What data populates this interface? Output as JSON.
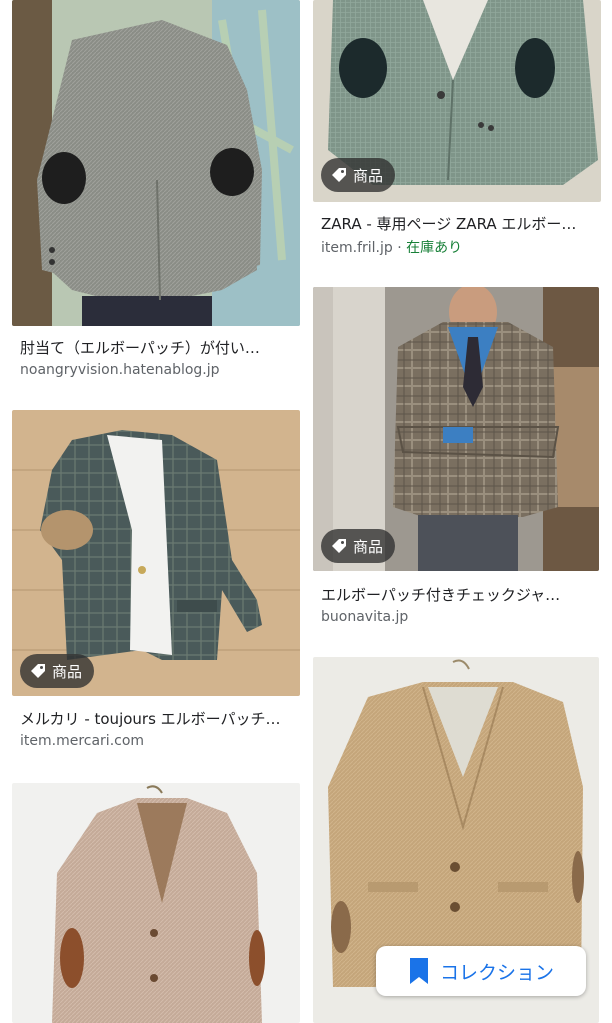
{
  "results": [
    {
      "title": "肘当て（エルボーパッチ）が付い…",
      "source": "noangryvision.hatenablog.jp"
    },
    {
      "title": "ZARA - 専用ページ ZARA エルボー…",
      "source": "item.fril.jp",
      "separator": " · ",
      "stock": "在庫あり",
      "badge": "商品"
    },
    {
      "title": "エルボーパッチ付きチェックジャ…",
      "source": "buonavita.jp",
      "badge": "商品"
    },
    {
      "title": "メルカリ - toujours エルボーパッチ…",
      "source": "item.mercari.com",
      "badge": "商品"
    }
  ],
  "collection_button": {
    "label": "コレクション",
    "icon": "bookmark-icon"
  },
  "colors": {
    "badge_bg": "#303030",
    "link_blue": "#1a73e8",
    "stock_green": "#188038",
    "source_grey": "#5f6368"
  }
}
